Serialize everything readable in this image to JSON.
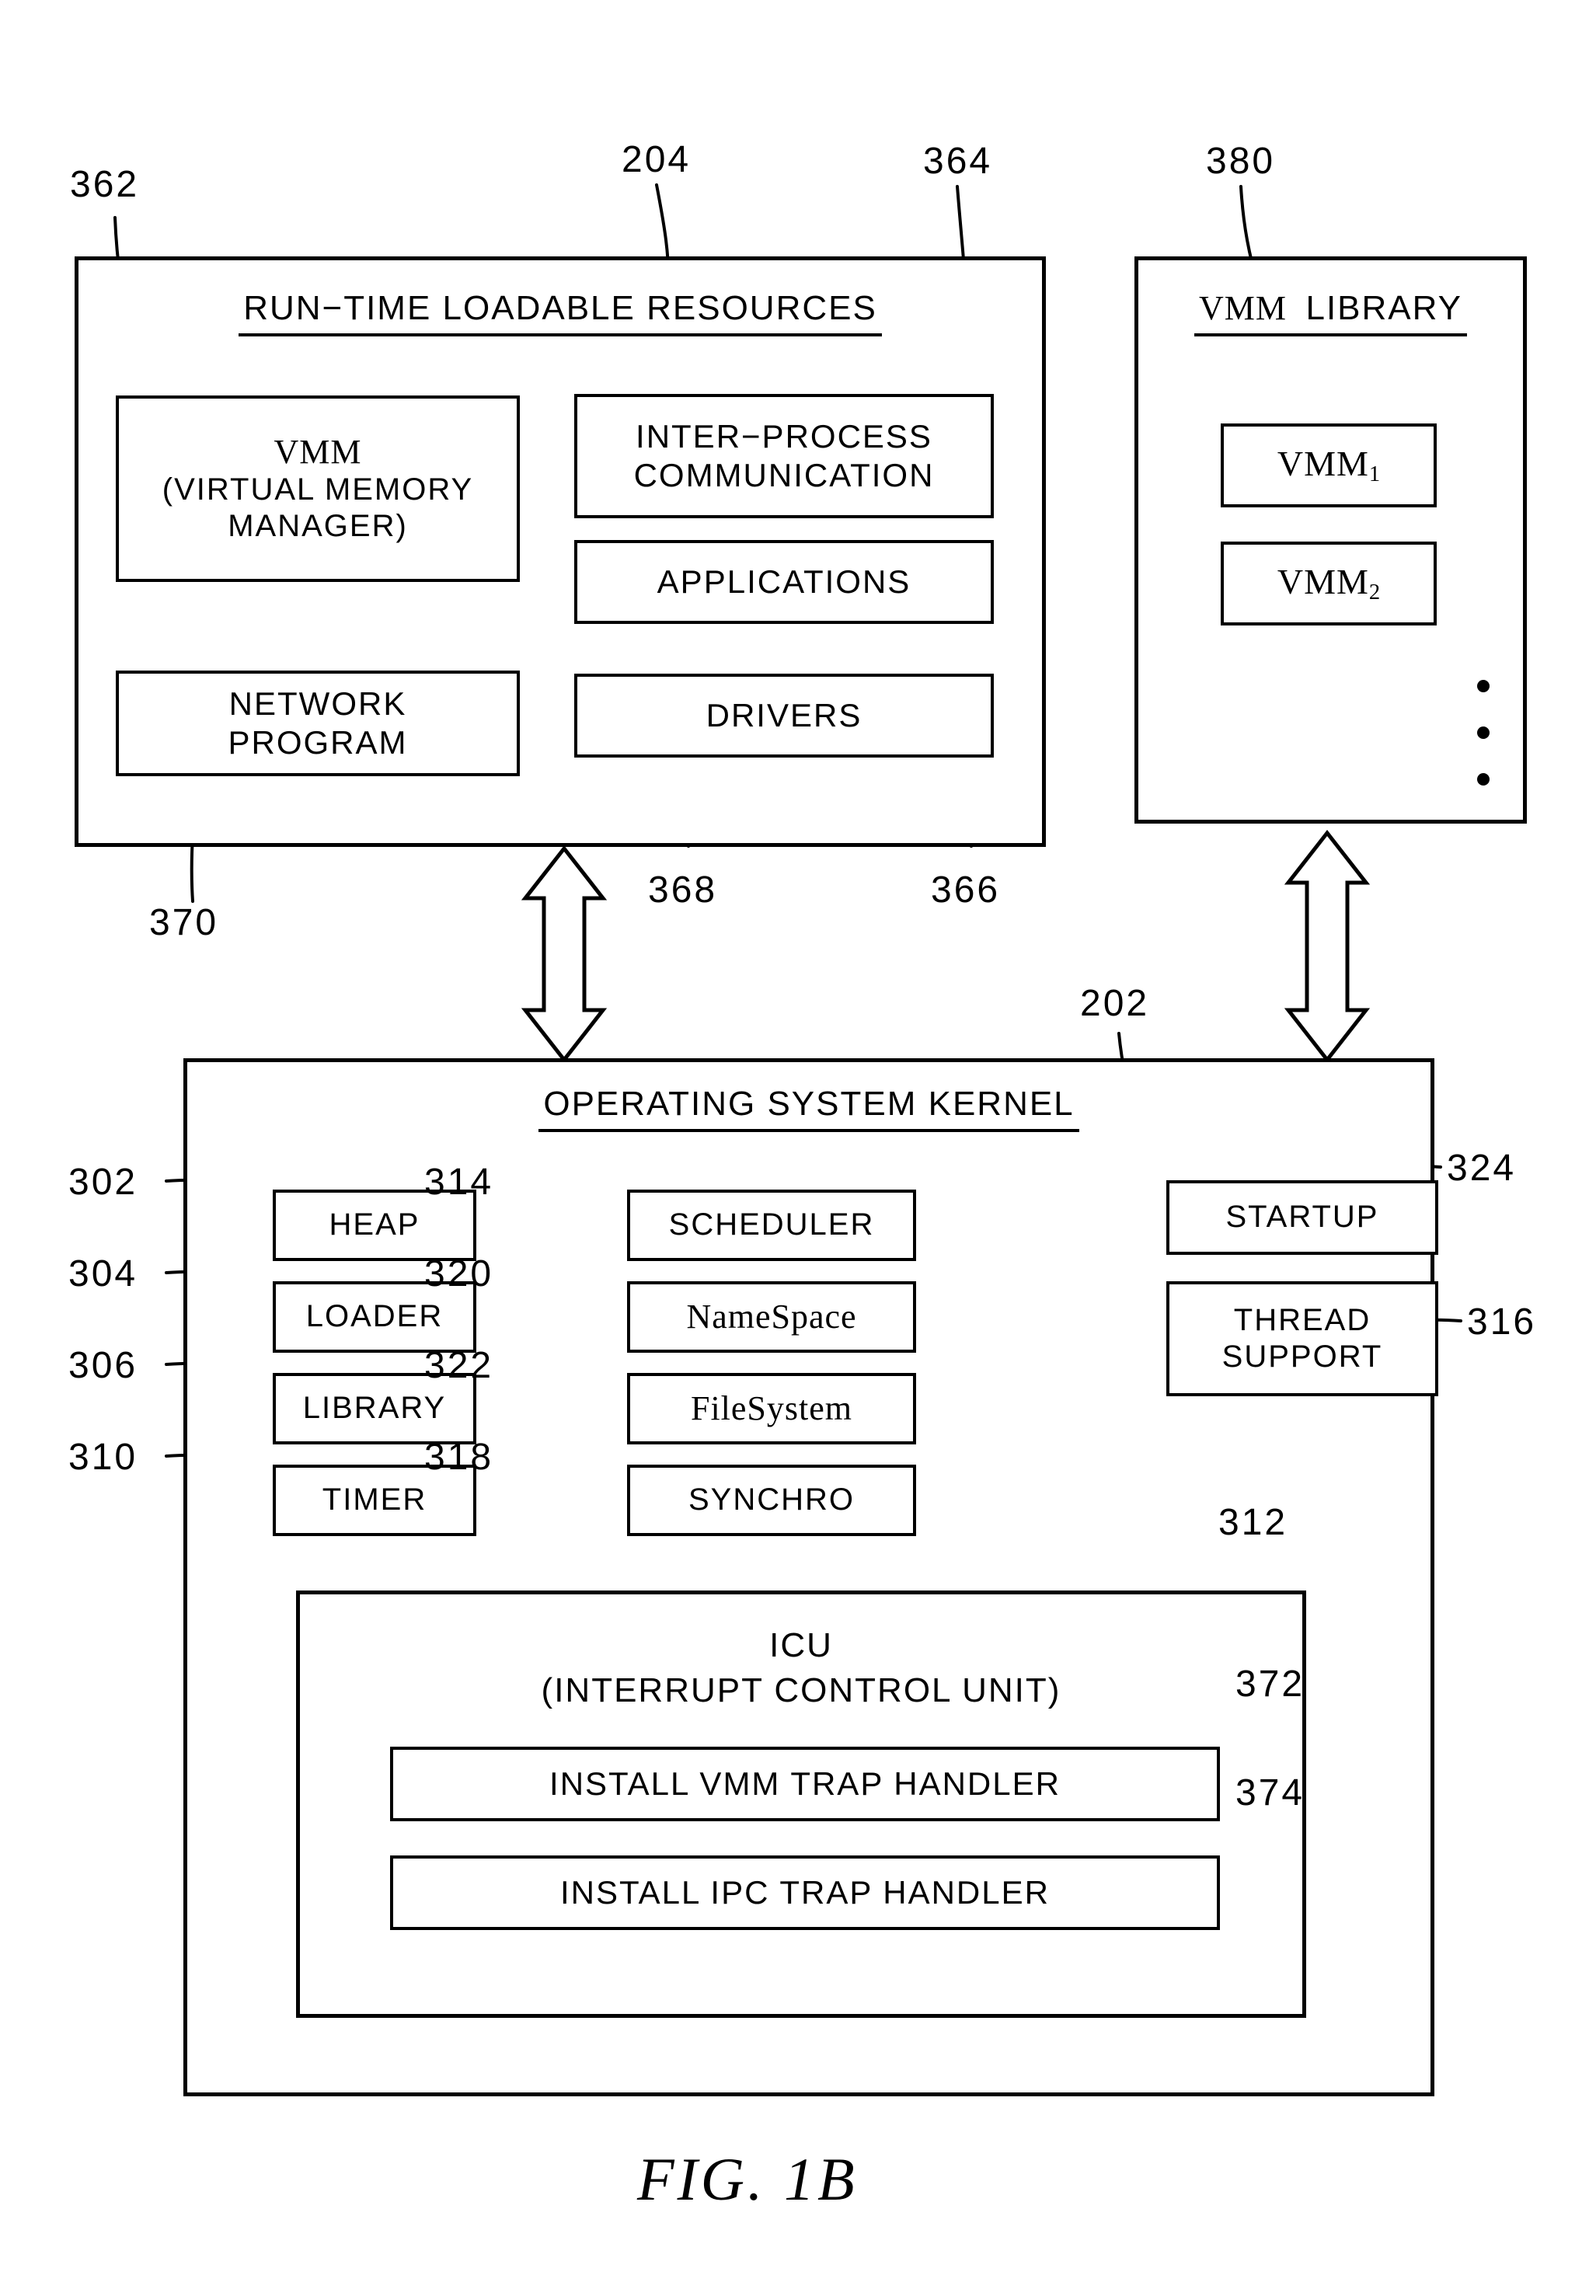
{
  "figure": {
    "label": "FIG.  1B"
  },
  "panels": {
    "runtime": {
      "title": "RUN−TIME LOADABLE RESOURCES",
      "ref": "204",
      "boxes": [
        {
          "id": "vmm",
          "line1": "VMM",
          "line2": "(VIRTUAL  MEMORY",
          "line3": "MANAGER)",
          "ref": "362"
        },
        {
          "id": "ipc",
          "line1": "INTER−PROCESS",
          "line2": "COMMUNICATION",
          "ref": "364"
        },
        {
          "id": "applications",
          "line1": "APPLICATIONS",
          "ref": "368"
        },
        {
          "id": "drivers",
          "line1": "DRIVERS",
          "ref": "366"
        },
        {
          "id": "network-program",
          "line1": "NETWORK",
          "line2": "PROGRAM",
          "ref": "370"
        }
      ]
    },
    "vmm_library": {
      "title_serif": "VMM",
      "title_sans": "LIBRARY",
      "ref": "380",
      "items": [
        {
          "name": "VMM",
          "subscript": "1"
        },
        {
          "name": "VMM",
          "subscript": "2"
        }
      ],
      "ellipsis_dots": 3
    },
    "kernel": {
      "title": "OPERATING  SYSTEM  KERNEL",
      "ref": "202",
      "left_column": [
        {
          "label": "HEAP",
          "ref": "302"
        },
        {
          "label": "LOADER",
          "ref": "304"
        },
        {
          "label": "LIBRARY",
          "ref": "306"
        },
        {
          "label": "TIMER",
          "ref": "310"
        }
      ],
      "middle_column": [
        {
          "label": "SCHEDULER",
          "ref": "314",
          "style": "sans"
        },
        {
          "label": "NameSpace",
          "ref": "320",
          "style": "serif"
        },
        {
          "label": "FileSystem",
          "ref": "322",
          "style": "serif"
        },
        {
          "label": "SYNCHRO",
          "ref": "318",
          "style": "sans"
        }
      ],
      "right_column": [
        {
          "label": "STARTUP",
          "ref": "324"
        },
        {
          "label_line1": "THREAD",
          "label_line2": "SUPPORT",
          "ref": "316"
        }
      ],
      "icu": {
        "title_line1": "ICU",
        "title_line2": "(INTERRUPT  CONTROL  UNIT)",
        "ref": "312",
        "handlers": [
          {
            "label": "INSTALL VMM TRAP HANDLER",
            "ref": "372"
          },
          {
            "label": "INSTALL IPC TRAP HANDLER",
            "ref": "374"
          }
        ]
      }
    }
  },
  "connectors": {
    "left_arrow_name": "runtime-to-kernel-arrow",
    "right_arrow_name": "vmmlibrary-to-kernel-arrow"
  }
}
